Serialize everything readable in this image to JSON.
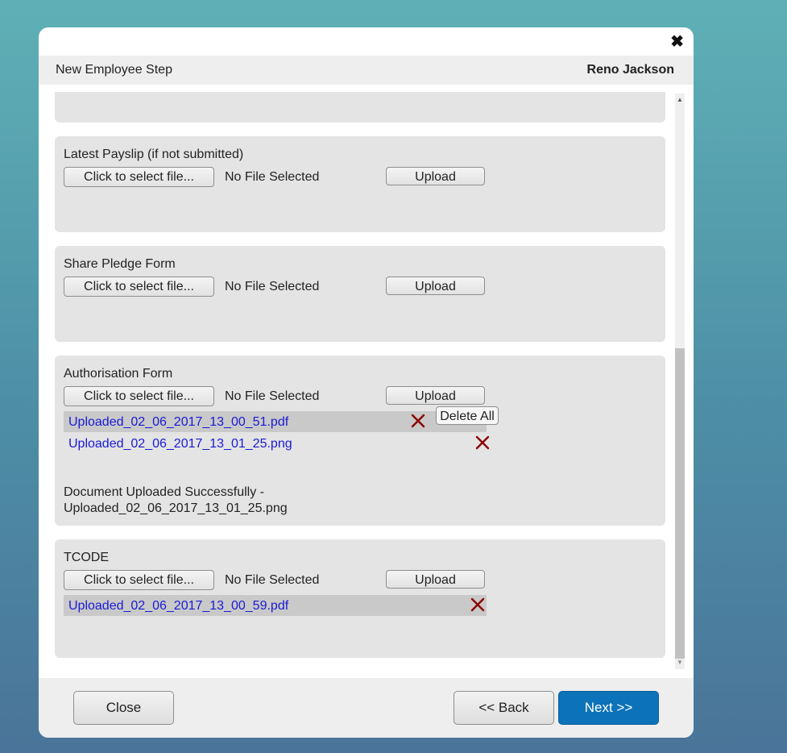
{
  "modal": {
    "close_glyph": "✖",
    "title": "New Employee Step",
    "user_name": "Reno Jackson"
  },
  "sections": [
    {
      "title": "Latest Payslip (if not submitted)",
      "select_label": "Click to select file...",
      "file_status": "No File Selected",
      "upload_label": "Upload"
    },
    {
      "title": "Share Pledge Form",
      "select_label": "Click to select file...",
      "file_status": "No File Selected",
      "upload_label": "Upload"
    },
    {
      "title": "Authorisation Form",
      "select_label": "Click to select file...",
      "file_status": "No File Selected",
      "upload_label": "Upload",
      "files": [
        "Uploaded_02_06_2017_13_00_51.pdf",
        "Uploaded_02_06_2017_13_01_25.png"
      ],
      "delete_all_tooltip": "Delete All",
      "message_line1": "Document Uploaded Successfully -",
      "message_line2": "Uploaded_02_06_2017_13_01_25.png"
    },
    {
      "title": "TCODE",
      "select_label": "Click to select file...",
      "file_status": "No File Selected",
      "upload_label": "Upload",
      "files": [
        "Uploaded_02_06_2017_13_00_59.pdf"
      ]
    }
  ],
  "footer": {
    "close_label": "Close",
    "back_label": "<< Back",
    "next_label": "Next >>"
  },
  "colors": {
    "primary": "#0c72b9",
    "link": "#1a1ad6",
    "delete_icon": "#8b0000",
    "section_bg": "#e4e4e4"
  }
}
